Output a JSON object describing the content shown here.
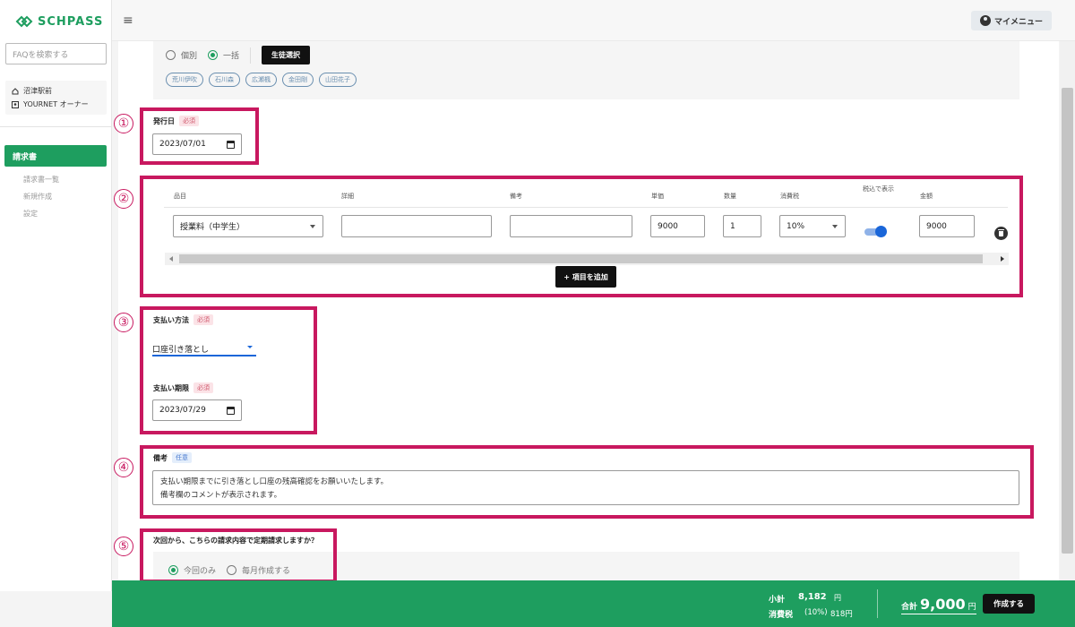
{
  "app": {
    "logo_text": "SCHPASS",
    "brand_color": "#1e9e5f",
    "accent_color": "#c8185f"
  },
  "sidebar": {
    "faq_placeholder": "FAQを検索する",
    "school_name": "沼津駅前",
    "owner_label": "YOURNET オーナー",
    "active_item": "請求書",
    "sub_items": [
      "請求書一覧",
      "新規作成",
      "設定"
    ]
  },
  "header": {
    "menu_label": "マイメニュー"
  },
  "recipients": {
    "mode_individual": "個別",
    "mode_bulk": "一括",
    "select_students_button": "生徒選択",
    "students": [
      "荒川伊吹",
      "石川森",
      "広瀬楓",
      "金田剛",
      "山田花子"
    ]
  },
  "issue_date": {
    "label": "発行日",
    "required_badge": "必須",
    "value": "2023/07/01"
  },
  "items_table": {
    "headers": {
      "item": "品目",
      "detail": "詳細",
      "note": "備考",
      "unit_price": "単価",
      "quantity": "数量",
      "tax": "消費税",
      "tax_inclusive": "税込で表示",
      "amount": "金額"
    },
    "row": {
      "item": "授業料（中学生）",
      "detail": "",
      "note": "",
      "unit_price": "9000",
      "quantity": "1",
      "tax": "10%",
      "tax_inclusive": true,
      "amount": "9000"
    },
    "add_button": "+ 項目を追加"
  },
  "payment": {
    "method_label": "支払い方法",
    "method_required": "必須",
    "method_value": "口座引き落とし",
    "due_label": "支払い期限",
    "due_required": "必須",
    "due_value": "2023/07/29"
  },
  "remarks": {
    "label": "備考",
    "optional_badge": "任意",
    "line1": "支払い期限までに引き落とし口座の残高確認をお願いいたします。",
    "line2": "備考欄のコメントが表示されます。"
  },
  "recurring": {
    "question": "次回から、こちらの請求内容で定期請求しますか？",
    "option_once": "今回のみ",
    "option_monthly": "毎月作成する",
    "selected": "今回のみ"
  },
  "callouts": [
    "①",
    "②",
    "③",
    "④",
    "⑤"
  ],
  "footer": {
    "subtotal_label": "小計",
    "subtotal_value": "8,182",
    "yen": "円",
    "tax_label": "消費税",
    "tax_rate": "(10%)",
    "tax_value": "818円",
    "total_label": "合計",
    "total_value": "9,000",
    "create_button": "作成する"
  }
}
